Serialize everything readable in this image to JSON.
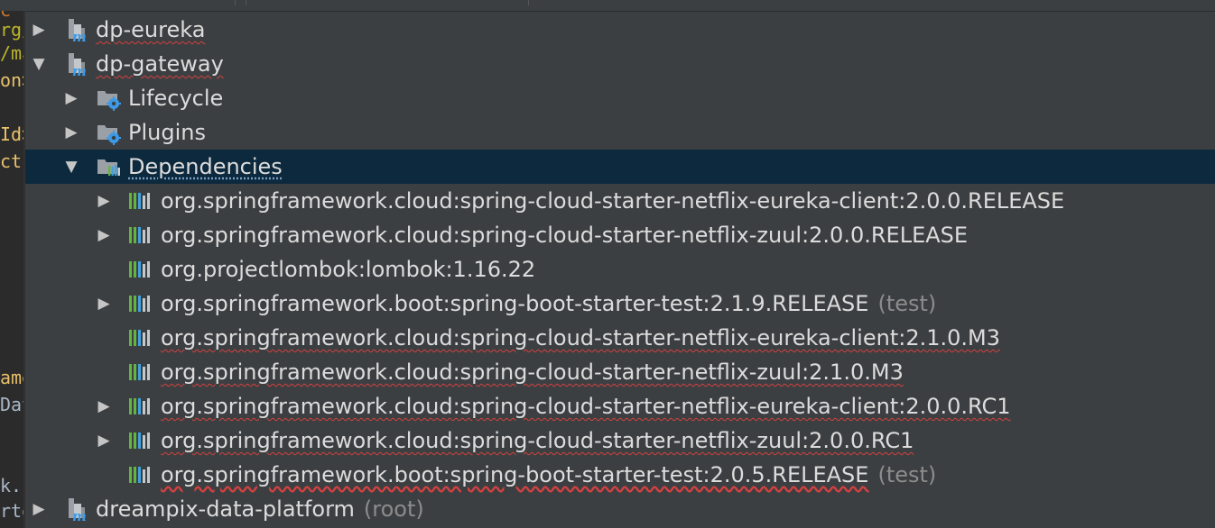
{
  "editor_fragments": [
    "c",
    "rg/",
    "/ma",
    "on>",
    "Id>",
    "ctI",
    "ame",
    "Dat",
    "k.b",
    "rte"
  ],
  "tree": {
    "modules": [
      {
        "name": "dp-eureka",
        "expanded": false
      },
      {
        "name": "dp-gateway",
        "expanded": true
      },
      {
        "name": "dreampix-data-platform",
        "suffix": "(root)",
        "expanded": false
      }
    ],
    "folders": [
      {
        "name": "Lifecycle"
      },
      {
        "name": "Plugins"
      },
      {
        "name": "Dependencies"
      }
    ],
    "dependencies": [
      {
        "name": "org.springframework.cloud:spring-cloud-starter-netflix-eureka-client:2.0.0.RELEASE",
        "suffix": ""
      },
      {
        "name": "org.springframework.cloud:spring-cloud-starter-netflix-zuul:2.0.0.RELEASE",
        "suffix": ""
      },
      {
        "name": "org.projectlombok:lombok:1.16.22",
        "suffix": ""
      },
      {
        "name": "org.springframework.boot:spring-boot-starter-test:2.1.9.RELEASE",
        "suffix": "(test)"
      },
      {
        "name": "org.springframework.cloud:spring-cloud-starter-netflix-eureka-client:2.1.0.M3",
        "suffix": ""
      },
      {
        "name": "org.springframework.cloud:spring-cloud-starter-netflix-zuul:2.1.0.M3",
        "suffix": ""
      },
      {
        "name": "org.springframework.cloud:spring-cloud-starter-netflix-eureka-client:2.0.0.RC1",
        "suffix": ""
      },
      {
        "name": "org.springframework.cloud:spring-cloud-starter-netflix-zuul:2.0.0.RC1",
        "suffix": ""
      },
      {
        "name": "org.springframework.boot:spring-boot-starter-test:2.0.5.RELEASE",
        "suffix": "(test)"
      }
    ]
  },
  "colors": {
    "background": "#3c3f41",
    "selection": "#0d293e",
    "text": "#dcdcdc",
    "muted": "#8c8c8c",
    "error_underline": "#d54040",
    "maven_icon": "#2f7fc1",
    "gear_icon": "#3d9ae8",
    "bar_green": "#62b543",
    "bar_blue": "#40a0e0"
  },
  "icons": {
    "module": "maven-module-icon",
    "lifecycle": "folder-gear-icon",
    "plugins": "folder-gear-icon",
    "dependencies": "folder-library-icon",
    "dependency": "library-bars-icon",
    "expand": "triangle-right-icon",
    "collapse": "triangle-down-icon"
  }
}
